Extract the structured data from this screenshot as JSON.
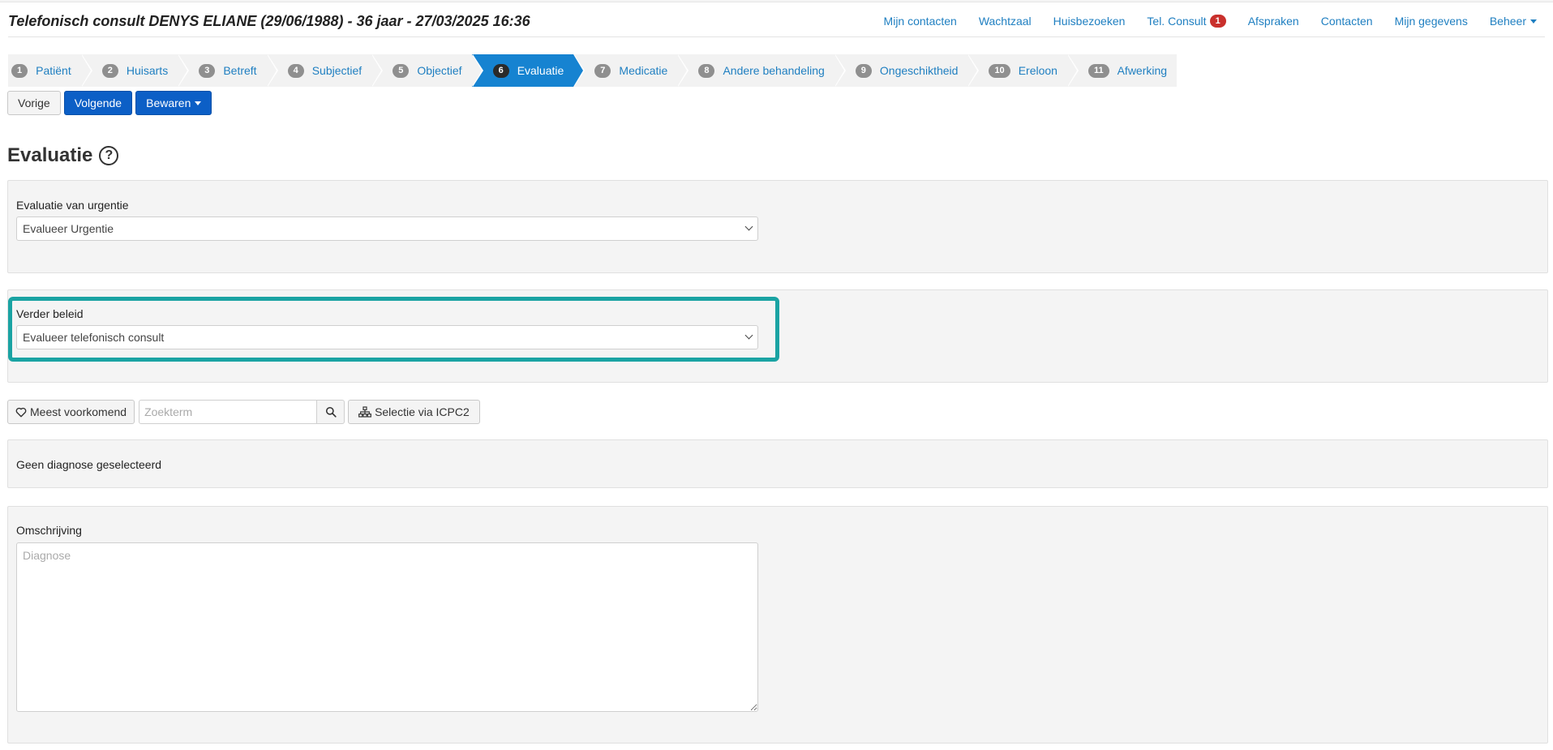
{
  "header": {
    "title": "Telefonisch consult DENYS ELIANE (29/06/1988) - 36 jaar - 27/03/2025 16:36",
    "nav": {
      "mijn_contacten": "Mijn contacten",
      "wachtzaal": "Wachtzaal",
      "huisbezoeken": "Huisbezoeken",
      "tel_consult": "Tel. Consult",
      "tel_consult_badge": "1",
      "afspraken": "Afspraken",
      "contacten": "Contacten",
      "mijn_gegevens": "Mijn gegevens",
      "beheer": "Beheer"
    }
  },
  "steps": [
    {
      "num": "1",
      "label": "Patiënt"
    },
    {
      "num": "2",
      "label": "Huisarts"
    },
    {
      "num": "3",
      "label": "Betreft"
    },
    {
      "num": "4",
      "label": "Subjectief"
    },
    {
      "num": "5",
      "label": "Objectief"
    },
    {
      "num": "6",
      "label": "Evaluatie"
    },
    {
      "num": "7",
      "label": "Medicatie"
    },
    {
      "num": "8",
      "label": "Andere behandeling"
    },
    {
      "num": "9",
      "label": "Ongeschiktheid"
    },
    {
      "num": "10",
      "label": "Ereloon"
    },
    {
      "num": "11",
      "label": "Afwerking"
    }
  ],
  "active_step": "6",
  "toolbar": {
    "vorige": "Vorige",
    "volgende": "Volgende",
    "bewaren": "Bewaren"
  },
  "page": {
    "title": "Evaluatie",
    "help": "?"
  },
  "urgentie": {
    "label": "Evaluatie van urgentie",
    "value": "Evalueer Urgentie"
  },
  "beleid": {
    "label": "Verder beleid",
    "value": "Evalueer telefonisch consult"
  },
  "diagnose_search": {
    "meest_voorkomend": "Meest voorkomend",
    "placeholder": "Zoekterm",
    "icpc2": "Selectie via ICPC2"
  },
  "diagnose": {
    "empty_text": "Geen diagnose geselecteerd"
  },
  "omschrijving": {
    "label": "Omschrijving",
    "placeholder": "Diagnose"
  },
  "colors": {
    "link": "#1f7fc1",
    "primary": "#0c5fc6",
    "active_step": "#1683d1",
    "highlight": "#1aa3a3",
    "badge": "#c9302c"
  }
}
